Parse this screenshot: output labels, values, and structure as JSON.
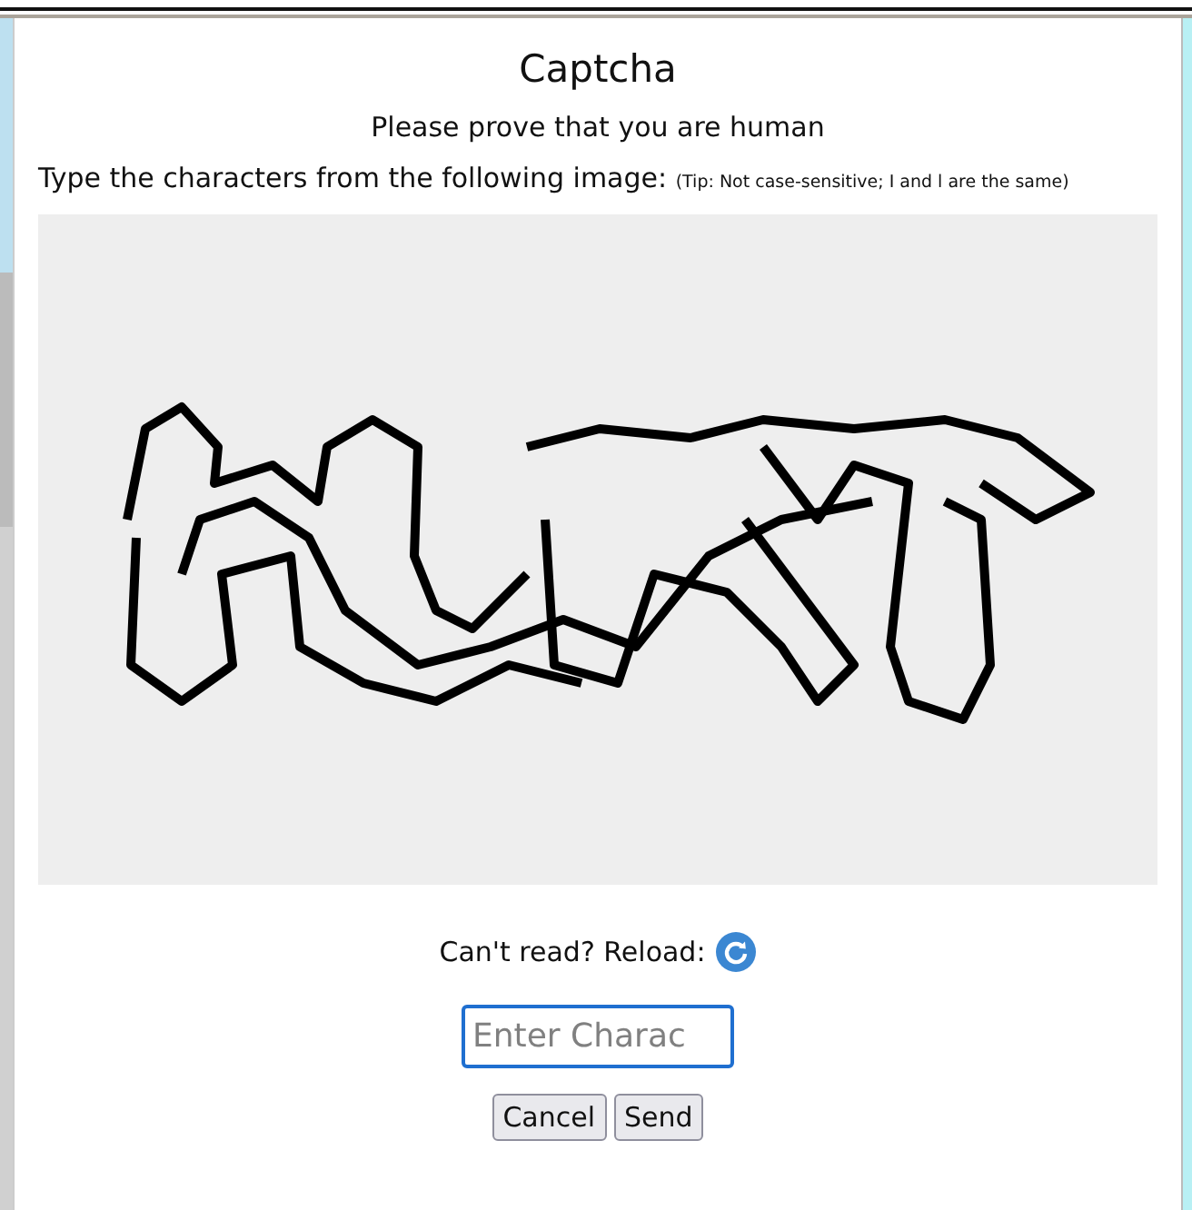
{
  "dialog": {
    "title": "Captcha",
    "subtitle": "Please prove that you are human",
    "instruction": "Type the characters from the following image:",
    "tip": "(Tip: Not case-sensitive; I and l are the same)"
  },
  "reload": {
    "label": "Can't read? Reload:"
  },
  "answer": {
    "placeholder": "Enter Charac"
  },
  "buttons": [
    {
      "label": "Cancel"
    },
    {
      "label": "Send"
    }
  ]
}
